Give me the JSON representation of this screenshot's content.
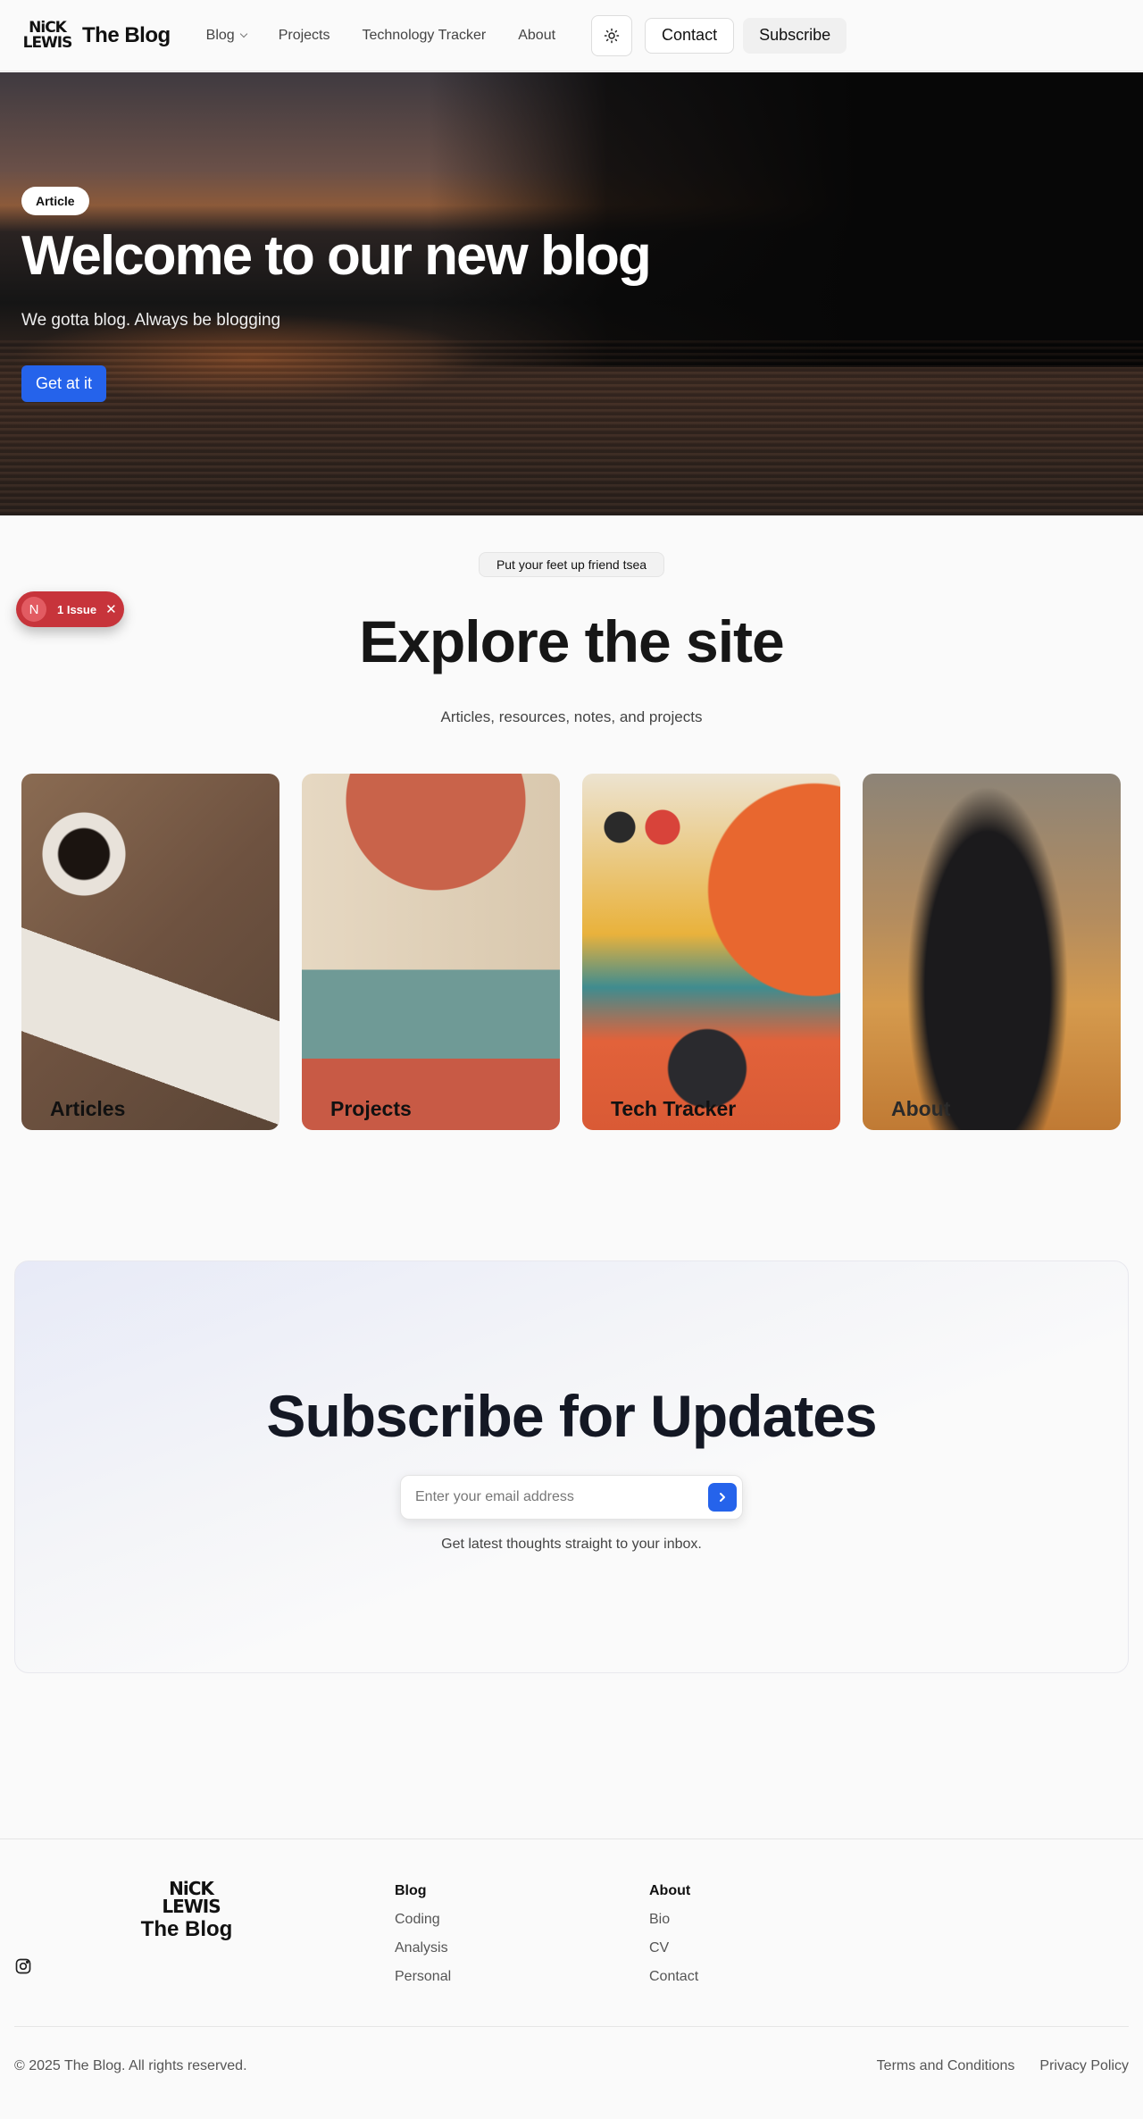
{
  "header": {
    "logo_mark_line1": "NiCK",
    "logo_mark_line2": "LEWIS",
    "site_title": "The Blog",
    "nav": [
      {
        "label": "Blog",
        "has_dropdown": true
      },
      {
        "label": "Projects"
      },
      {
        "label": "Technology Tracker"
      },
      {
        "label": "About"
      }
    ],
    "theme_icon": "sun-icon",
    "contact_label": "Contact",
    "subscribe_label": "Subscribe"
  },
  "hero": {
    "badge": "Article",
    "title": "Welcome to our new blog",
    "subtitle": "We gotta blog. Always be blogging",
    "cta": "Get at it"
  },
  "issue_toast": {
    "avatar_letter": "N",
    "label": "1 Issue",
    "close_icon": "close-icon"
  },
  "explore": {
    "pill": "Put your feet up friend tsea",
    "title": "Explore the site",
    "subtitle": "Articles, resources, notes, and projects",
    "cards": [
      {
        "label": "Articles"
      },
      {
        "label": "Projects"
      },
      {
        "label": "Tech Tracker"
      },
      {
        "label": "About"
      }
    ]
  },
  "subscribe": {
    "title": "Subscribe for Updates",
    "placeholder": "Enter your email address",
    "note": "Get latest thoughts straight to your inbox."
  },
  "footer": {
    "logo_mark_line1": "NiCK",
    "logo_mark_line2": "LEWIS",
    "site_title": "The Blog",
    "social_icon": "instagram-icon",
    "columns": [
      {
        "heading": "Blog",
        "links": [
          "Coding",
          "Analysis",
          "Personal"
        ]
      },
      {
        "heading": "About",
        "links": [
          "Bio",
          "CV",
          "Contact"
        ]
      }
    ],
    "copyright": "© 2025 The Blog. All rights reserved.",
    "legal": [
      "Terms and Conditions",
      "Privacy Policy"
    ]
  },
  "colors": {
    "accent": "#2563eb",
    "issue_red": "#c7343b"
  }
}
